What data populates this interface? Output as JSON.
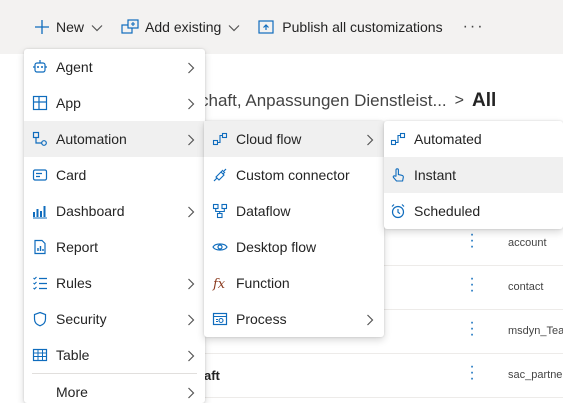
{
  "toolbar": {
    "new_label": "New",
    "add_existing_label": "Add existing",
    "publish_label": "Publish all customizations",
    "more_label": "···"
  },
  "breadcrumb": {
    "parent": "chaft, Anpassungen Dienstleist...",
    "separator": ">",
    "current": "All"
  },
  "table_rows": [
    {
      "name": "",
      "type": "account"
    },
    {
      "name": "",
      "type": "contact"
    },
    {
      "name": "",
      "type": "msdyn_Tea"
    },
    {
      "name": "aft",
      "type": "sac_partne"
    }
  ],
  "new_menu": {
    "items": [
      {
        "label": "Agent",
        "icon": "agent-icon",
        "has_submenu": true
      },
      {
        "label": "App",
        "icon": "app-icon",
        "has_submenu": true
      },
      {
        "label": "Automation",
        "icon": "automation-icon",
        "has_submenu": true,
        "active": true
      },
      {
        "label": "Card",
        "icon": "card-icon",
        "has_submenu": false
      },
      {
        "label": "Dashboard",
        "icon": "dashboard-icon",
        "has_submenu": true
      },
      {
        "label": "Report",
        "icon": "report-icon",
        "has_submenu": false
      },
      {
        "label": "Rules",
        "icon": "rules-icon",
        "has_submenu": true
      },
      {
        "label": "Security",
        "icon": "shield-icon",
        "has_submenu": true
      },
      {
        "label": "Table",
        "icon": "table-icon",
        "has_submenu": true
      },
      {
        "label": "More",
        "icon": "",
        "has_submenu": true
      }
    ]
  },
  "automation_menu": {
    "items": [
      {
        "label": "Cloud flow",
        "icon": "cloud-flow-icon",
        "has_submenu": true,
        "active": true
      },
      {
        "label": "Custom connector",
        "icon": "custom-connector-icon",
        "has_submenu": false
      },
      {
        "label": "Dataflow",
        "icon": "dataflow-icon",
        "has_submenu": false
      },
      {
        "label": "Desktop flow",
        "icon": "desktop-flow-icon",
        "has_submenu": false
      },
      {
        "label": "Function",
        "icon": "function-icon",
        "has_submenu": false
      },
      {
        "label": "Process",
        "icon": "process-icon",
        "has_submenu": true
      }
    ]
  },
  "cloud_flow_menu": {
    "items": [
      {
        "label": "Automated",
        "icon": "automated-flow-icon"
      },
      {
        "label": "Instant",
        "icon": "touch-icon",
        "active": true
      },
      {
        "label": "Scheduled",
        "icon": "clock-icon"
      }
    ]
  },
  "colors": {
    "accent": "#0f6cbd",
    "toolbar_bg": "#f3f2f1",
    "menu_active_bg": "#f0f0f0"
  }
}
